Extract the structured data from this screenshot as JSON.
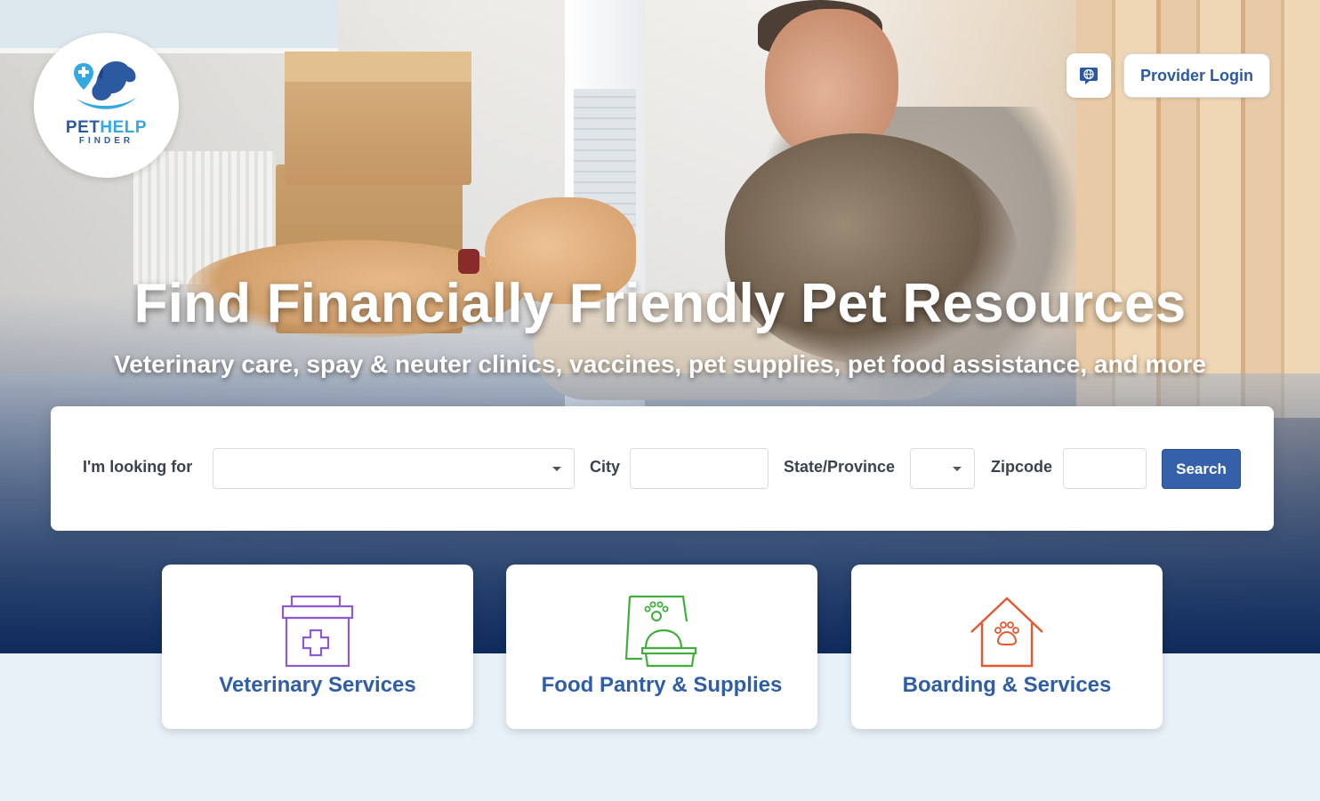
{
  "logo": {
    "main_a": "PET",
    "main_b": "HELP",
    "sub": "FINDER"
  },
  "header": {
    "globe_icon": "globe-icon",
    "provider_login_label": "Provider Login"
  },
  "hero": {
    "headline": "Find Financially Friendly Pet Resources",
    "subline": "Veterinary care, spay & neuter clinics, vaccines, pet supplies, pet food assistance, and more"
  },
  "search": {
    "looking_for_label": "I'm looking for",
    "looking_for_value": "",
    "city_label": "City",
    "city_value": "",
    "state_label": "State/Province",
    "state_value": "",
    "zip_label": "Zipcode",
    "zip_value": "",
    "button_label": "Search"
  },
  "categories": [
    {
      "label": "Veterinary Services",
      "icon": "first-aid-kit-icon",
      "color": "#8e5ad2"
    },
    {
      "label": "Food Pantry & Supplies",
      "icon": "pet-food-bag-icon",
      "color": "#3fae3a"
    },
    {
      "label": "Boarding & Services",
      "icon": "pet-house-icon",
      "color": "#e6582e"
    }
  ],
  "colors": {
    "brand_blue": "#2c5aa0",
    "accent_light_blue": "#34a9e0",
    "page_bg": "#e8f1f8"
  }
}
